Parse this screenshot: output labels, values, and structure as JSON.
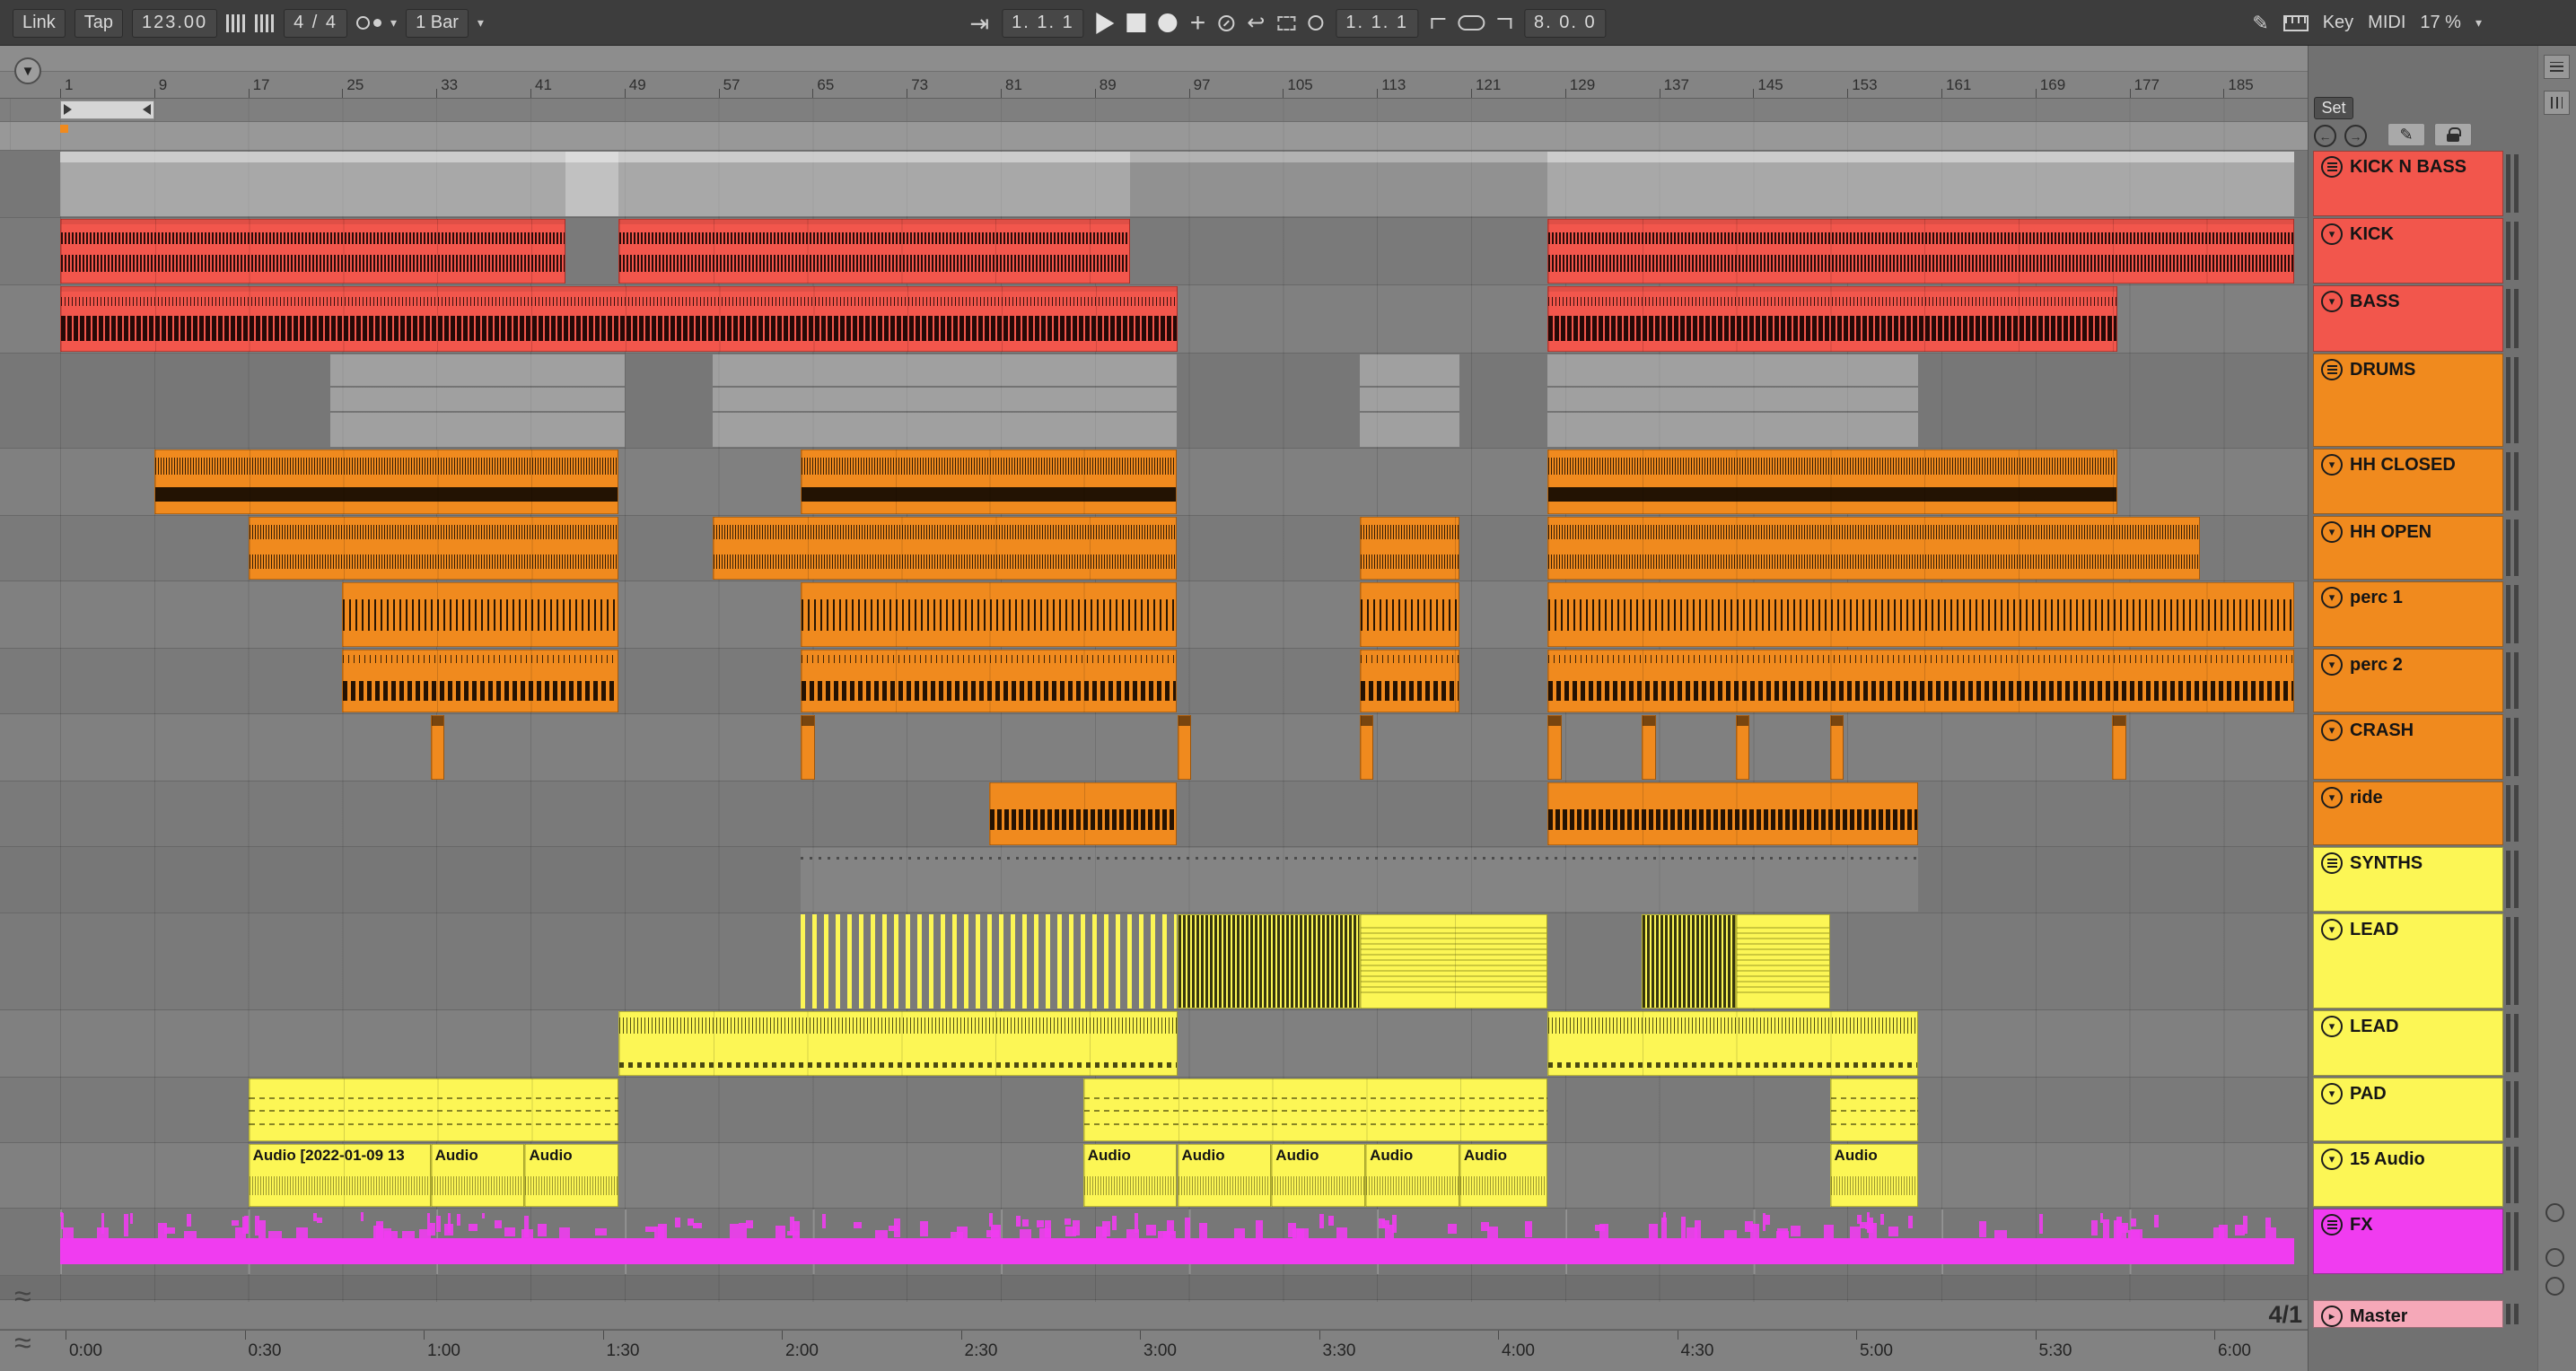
{
  "toolbar": {
    "link_label": "Link",
    "tap_label": "Tap",
    "tempo": "123.00",
    "time_signature": "4 / 4",
    "quantize": "1 Bar",
    "position": "1.  1.  1",
    "loop_start": "1.  1.  1",
    "loop_length": "8.  0.  0",
    "key_label": "Key",
    "midi_label": "MIDI",
    "cpu_load": "17 %"
  },
  "panel": {
    "set_label": "Set"
  },
  "arrangement": {
    "bar_numbers": [
      1,
      9,
      17,
      25,
      33,
      41,
      49,
      57,
      65,
      73,
      81,
      89,
      97,
      105,
      113,
      121,
      129,
      137,
      145,
      153,
      161,
      169,
      177,
      185
    ],
    "time_labels": [
      "0:00",
      "0:30",
      "1:00",
      "1:30",
      "2:00",
      "2:30",
      "3:00",
      "3:30",
      "4:00",
      "4:30",
      "5:00",
      "5:30",
      "6:00"
    ],
    "zoom_grid_label": "4/1"
  },
  "colors": {
    "red": "#f2564c",
    "orange": "#f08a1e",
    "yellow": "#fcf655",
    "magenta": "#f03cf0",
    "master_pink": "#f5a8b8"
  },
  "tracks": [
    {
      "name": "KICK N BASS",
      "kind": "group",
      "color": "red"
    },
    {
      "name": "KICK",
      "kind": "track",
      "color": "red"
    },
    {
      "name": "BASS",
      "kind": "track",
      "color": "red"
    },
    {
      "name": "DRUMS",
      "kind": "group",
      "color": "orange"
    },
    {
      "name": "HH CLOSED",
      "kind": "track",
      "color": "orange"
    },
    {
      "name": "HH OPEN",
      "kind": "track",
      "color": "orange"
    },
    {
      "name": "perc 1",
      "kind": "track",
      "color": "orange"
    },
    {
      "name": "perc 2",
      "kind": "track",
      "color": "orange"
    },
    {
      "name": "CRASH",
      "kind": "track",
      "color": "orange"
    },
    {
      "name": "ride",
      "kind": "track",
      "color": "orange"
    },
    {
      "name": "SYNTHS",
      "kind": "group",
      "color": "yellow"
    },
    {
      "name": "LEAD",
      "kind": "track",
      "color": "yellow"
    },
    {
      "name": "LEAD",
      "kind": "track",
      "color": "yellow"
    },
    {
      "name": "PAD",
      "kind": "track",
      "color": "yellow"
    },
    {
      "name": "15 Audio",
      "kind": "track",
      "color": "yellow"
    },
    {
      "name": "FX",
      "kind": "group",
      "color": "magenta"
    },
    {
      "name": "Master",
      "kind": "master",
      "color": "master_pink"
    }
  ],
  "clips": [
    {
      "t": 0,
      "s": 1,
      "e": 44,
      "p": "group-a"
    },
    {
      "t": 0,
      "s": 44,
      "e": 48.5,
      "p": "group-b"
    },
    {
      "t": 0,
      "s": 48.5,
      "e": 92,
      "p": "group-a"
    },
    {
      "t": 0,
      "s": 92,
      "e": 127.5,
      "p": "group-c"
    },
    {
      "t": 0,
      "s": 127.5,
      "e": 191,
      "p": "group-a"
    },
    {
      "t": 1,
      "s": 1,
      "e": 44,
      "p": "kick"
    },
    {
      "t": 1,
      "s": 48.5,
      "e": 92,
      "p": "kick"
    },
    {
      "t": 1,
      "s": 127.5,
      "e": 191,
      "p": "kick"
    },
    {
      "t": 2,
      "s": 1,
      "e": 96,
      "p": "bass"
    },
    {
      "t": 2,
      "s": 127.5,
      "e": 176,
      "p": "bass"
    },
    {
      "t": 3,
      "s": 24,
      "e": 49,
      "p": "group-d"
    },
    {
      "t": 3,
      "s": 56.5,
      "e": 96,
      "p": "group-d"
    },
    {
      "t": 3,
      "s": 111.5,
      "e": 120,
      "p": "group-d"
    },
    {
      "t": 3,
      "s": 127.5,
      "e": 159,
      "p": "group-d"
    },
    {
      "t": 4,
      "s": 9,
      "e": 48.5,
      "p": "hhclosed"
    },
    {
      "t": 4,
      "s": 64,
      "e": 96,
      "p": "hhclosed"
    },
    {
      "t": 4,
      "s": 127.5,
      "e": 176,
      "p": "hhclosed"
    },
    {
      "t": 5,
      "s": 17,
      "e": 48.5,
      "p": "hhopen"
    },
    {
      "t": 5,
      "s": 56.5,
      "e": 96,
      "p": "hhopen"
    },
    {
      "t": 5,
      "s": 111.5,
      "e": 120,
      "p": "hhopen"
    },
    {
      "t": 5,
      "s": 127.5,
      "e": 183,
      "p": "hhopen"
    },
    {
      "t": 6,
      "s": 25,
      "e": 48.5,
      "p": "perc1"
    },
    {
      "t": 6,
      "s": 64,
      "e": 96,
      "p": "perc1"
    },
    {
      "t": 6,
      "s": 111.5,
      "e": 120,
      "p": "perc1"
    },
    {
      "t": 6,
      "s": 127.5,
      "e": 191,
      "p": "perc1"
    },
    {
      "t": 7,
      "s": 25,
      "e": 48.5,
      "p": "perc2"
    },
    {
      "t": 7,
      "s": 64,
      "e": 96,
      "p": "perc2"
    },
    {
      "t": 7,
      "s": 111.5,
      "e": 120,
      "p": "perc2"
    },
    {
      "t": 7,
      "s": 127.5,
      "e": 191,
      "p": "perc2"
    },
    {
      "t": 8,
      "s": 32.5,
      "e": 33.7,
      "p": "crash"
    },
    {
      "t": 8,
      "s": 64,
      "e": 65.2,
      "p": "crash"
    },
    {
      "t": 8,
      "s": 96,
      "e": 97.2,
      "p": "crash"
    },
    {
      "t": 8,
      "s": 111.5,
      "e": 112.7,
      "p": "crash"
    },
    {
      "t": 8,
      "s": 127.5,
      "e": 128.7,
      "p": "crash"
    },
    {
      "t": 8,
      "s": 135.5,
      "e": 136.7,
      "p": "crash"
    },
    {
      "t": 8,
      "s": 143.5,
      "e": 144.7,
      "p": "crash"
    },
    {
      "t": 8,
      "s": 151.5,
      "e": 152.7,
      "p": "crash"
    },
    {
      "t": 8,
      "s": 175.5,
      "e": 176.7,
      "p": "crash"
    },
    {
      "t": 9,
      "s": 80,
      "e": 96,
      "p": "ride"
    },
    {
      "t": 9,
      "s": 127.5,
      "e": 159,
      "p": "ride"
    },
    {
      "t": 10,
      "s": 64,
      "e": 159,
      "p": "group-s"
    },
    {
      "t": 11,
      "s": 64,
      "e": 96,
      "p": "stems"
    },
    {
      "t": 11,
      "s": 96,
      "e": 111.5,
      "p": "ystripe"
    },
    {
      "t": 11,
      "s": 111.5,
      "e": 127.5,
      "p": "ysolid"
    },
    {
      "t": 11,
      "s": 135.5,
      "e": 143.5,
      "p": "ystripe"
    },
    {
      "t": 11,
      "s": 143.5,
      "e": 151.5,
      "p": "ysolid"
    },
    {
      "t": 12,
      "s": 48.5,
      "e": 96,
      "p": "lead2"
    },
    {
      "t": 12,
      "s": 127.5,
      "e": 159,
      "p": "lead2"
    },
    {
      "t": 13,
      "s": 17,
      "e": 48.5,
      "p": "pad"
    },
    {
      "t": 13,
      "s": 88,
      "e": 127.5,
      "p": "pad"
    },
    {
      "t": 13,
      "s": 151.5,
      "e": 159,
      "p": "pad"
    },
    {
      "t": 14,
      "s": 17,
      "e": 32.5,
      "p": "audio",
      "label": "Audio [2022-01-09 13"
    },
    {
      "t": 14,
      "s": 32.5,
      "e": 40.5,
      "p": "audio",
      "label": "Audio"
    },
    {
      "t": 14,
      "s": 40.5,
      "e": 48.5,
      "p": "audio",
      "label": "Audio"
    },
    {
      "t": 14,
      "s": 88,
      "e": 96,
      "p": "audio",
      "label": "Audio"
    },
    {
      "t": 14,
      "s": 96,
      "e": 104,
      "p": "audio",
      "label": "Audio"
    },
    {
      "t": 14,
      "s": 104,
      "e": 112,
      "p": "audio",
      "label": "Audio"
    },
    {
      "t": 14,
      "s": 112,
      "e": 120,
      "p": "audio",
      "label": "Audio"
    },
    {
      "t": 14,
      "s": 120,
      "e": 127.5,
      "p": "audio",
      "label": "Audio"
    },
    {
      "t": 14,
      "s": 151.5,
      "e": 159,
      "p": "audio",
      "label": "Audio"
    },
    {
      "t": 15,
      "s": 1,
      "e": 191,
      "p": "fx"
    }
  ]
}
